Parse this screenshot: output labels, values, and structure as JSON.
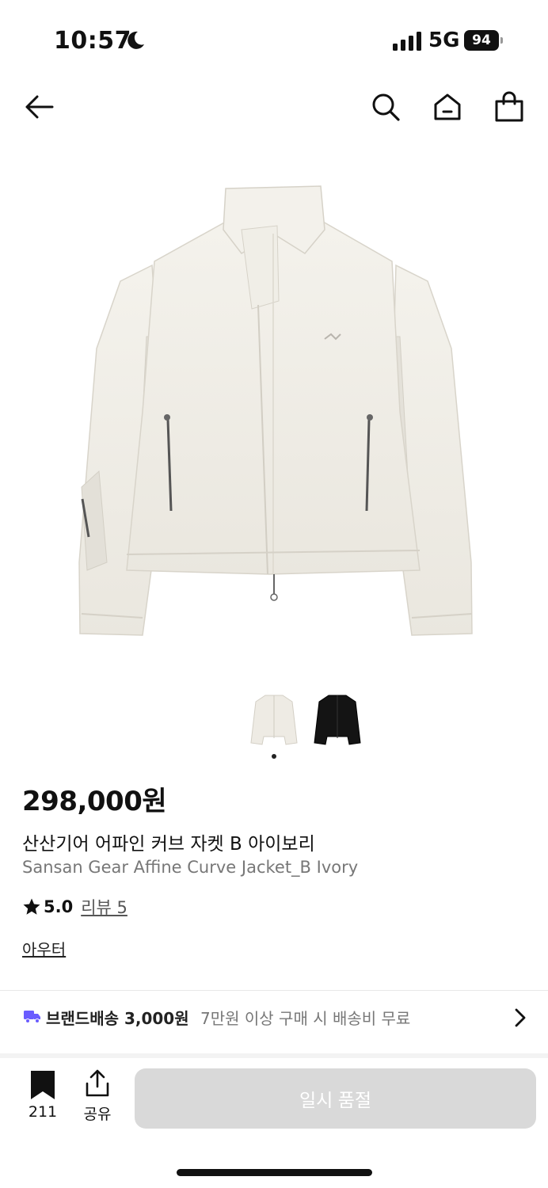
{
  "status_bar": {
    "time": "10:57",
    "network": "5G",
    "battery": "94"
  },
  "nav": {
    "icons": [
      "back-arrow-icon",
      "search-icon",
      "home-icon",
      "shopping-bag-icon"
    ]
  },
  "product": {
    "image_count": 2,
    "selected_image_index": 0,
    "price": "298,000원",
    "name_ko": "산산기어 어파인 커브 자켓 B 아이보리",
    "name_en": "Sansan Gear Affine Curve Jacket_B Ivory",
    "rating": "5.0",
    "review_label": "리뷰 5",
    "category": "아우터"
  },
  "shipping": {
    "label": "브랜드배송 3,000원",
    "condition": "7만원 이상 구매 시 배송비 무료"
  },
  "bottom_bar": {
    "bookmark_count": "211",
    "share_label": "공유",
    "buy_label": "일시 품절"
  },
  "colors": {
    "ivory": "#efede6",
    "black": "#111111",
    "disabled_button": "#d9d9d9",
    "accent": "#6a5cff"
  }
}
